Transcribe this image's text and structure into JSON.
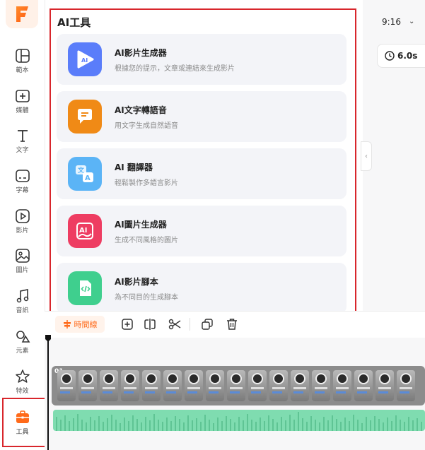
{
  "sidebar": {
    "items": [
      {
        "label": "範本",
        "icon": "template-icon"
      },
      {
        "label": "媒體",
        "icon": "media-add-icon"
      },
      {
        "label": "文字",
        "icon": "text-icon"
      },
      {
        "label": "字幕",
        "icon": "subtitle-icon"
      },
      {
        "label": "影片",
        "icon": "video-icon"
      },
      {
        "label": "圖片",
        "icon": "image-icon"
      },
      {
        "label": "音訊",
        "icon": "music-icon"
      },
      {
        "label": "元素",
        "icon": "elements-icon"
      },
      {
        "label": "特效",
        "icon": "effects-icon"
      },
      {
        "label": "工具",
        "icon": "toolbox-icon",
        "active": true
      }
    ]
  },
  "panel": {
    "title": "AI工具",
    "cards": [
      {
        "title": "AI影片生成器",
        "subtitle": "根據您的提示，文章或連結來生成影片",
        "icon": "ai-video-icon",
        "color": "#5a7dfa"
      },
      {
        "title": "AI文字轉語音",
        "subtitle": "用文字生成自然語音",
        "icon": "speech-bubble-icon",
        "color": "#f08a16"
      },
      {
        "title": "AI 翻譯器",
        "subtitle": "輕鬆製作多語言影片",
        "icon": "translate-icon",
        "color": "#5bb4f6"
      },
      {
        "title": "AI圖片生成器",
        "subtitle": "生成不同風格的圖片",
        "icon": "ai-image-icon",
        "color": "#ee3d62"
      },
      {
        "title": "AI影片腳本",
        "subtitle": "為不同目的生成腳本",
        "icon": "script-code-icon",
        "color": "#3fcf8e"
      }
    ]
  },
  "header": {
    "ratio": "9:16",
    "duration": "6.0s"
  },
  "timeline": {
    "button_label": "時間線",
    "video_label": "01"
  },
  "colors": {
    "accent": "#ff6a1a",
    "highlight": "#d8262c",
    "audio": "#7fdcb0"
  }
}
